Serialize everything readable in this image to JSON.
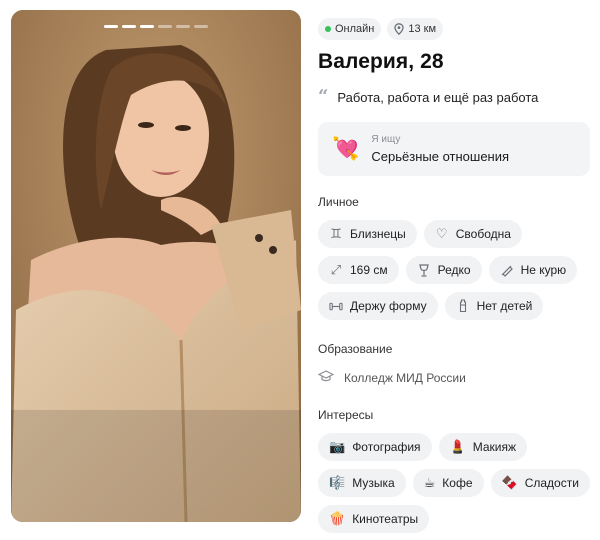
{
  "gallery": {
    "count": 6,
    "active": 3
  },
  "status": {
    "online": "Онлайн",
    "distance": "13 км"
  },
  "profile": {
    "name_age": "Валерия, 28",
    "bio": "Работа, работа и ещё раз работа"
  },
  "seeking": {
    "label": "Я ищу",
    "value": "Серьёзные отношения"
  },
  "personal": {
    "title": "Личное",
    "items": [
      {
        "icon": "gemini-icon",
        "label": "Близнецы"
      },
      {
        "icon": "heart-outline-icon",
        "label": "Свободна"
      },
      {
        "icon": "height-icon",
        "label": "169 см"
      },
      {
        "icon": "wine-glass-icon",
        "label": "Редко"
      },
      {
        "icon": "no-smoking-icon",
        "label": "Не курю"
      },
      {
        "icon": "dumbbell-icon",
        "label": "Держу форму"
      },
      {
        "icon": "baby-bottle-icon",
        "label": "Нет детей"
      }
    ]
  },
  "education": {
    "title": "Образование",
    "value": "Колледж МИД России"
  },
  "interests": {
    "title": "Интересы",
    "items": [
      {
        "icon": "camera-icon",
        "emoji": "📷",
        "label": "Фотография"
      },
      {
        "icon": "lipstick-icon",
        "emoji": "💄",
        "label": "Макияж"
      },
      {
        "icon": "music-icon",
        "emoji": "🎼",
        "label": "Музыка"
      },
      {
        "icon": "coffee-icon",
        "emoji": "☕",
        "label": "Кофе"
      },
      {
        "icon": "chocolate-icon",
        "emoji": "🍫",
        "label": "Сладости"
      },
      {
        "icon": "popcorn-icon",
        "emoji": "🍿",
        "label": "Кинотеатры"
      }
    ]
  },
  "colors": {
    "online": "#35c25b",
    "chip_bg": "#f1f2f4",
    "photo_bg": "#a47e53"
  }
}
